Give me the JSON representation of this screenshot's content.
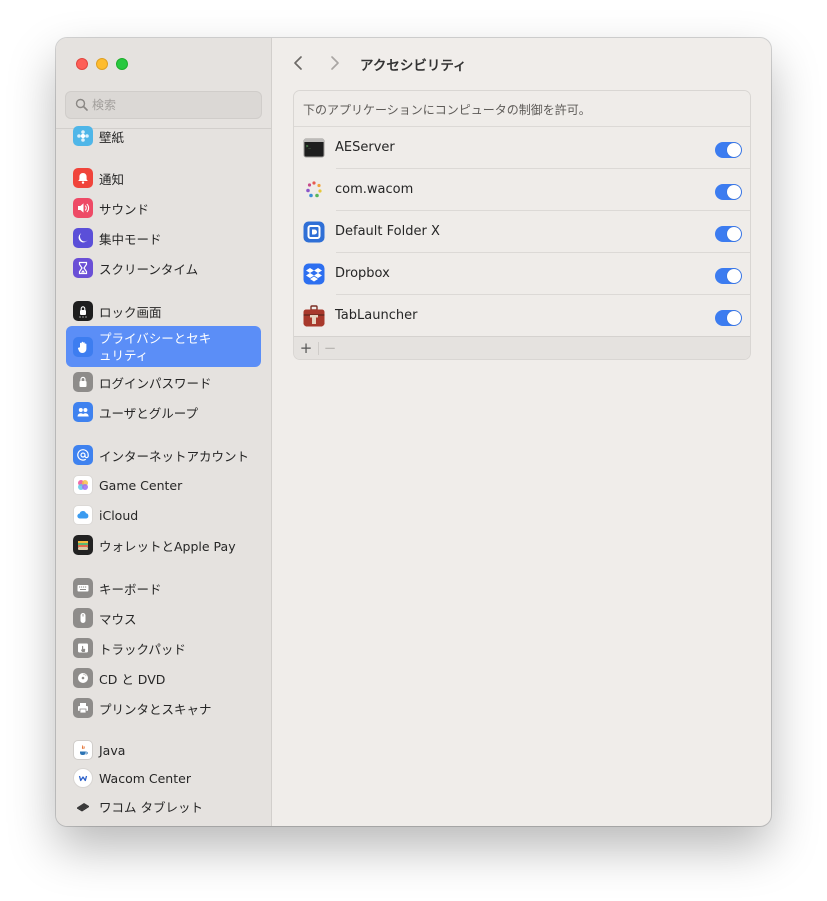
{
  "search": {
    "placeholder": "検索"
  },
  "sidebar": {
    "items": [
      {
        "label": "壁紙",
        "icon": "wallpaper-icon"
      },
      {
        "label": "通知",
        "icon": "bell-icon"
      },
      {
        "label": "サウンド",
        "icon": "speaker-icon"
      },
      {
        "label": "集中モード",
        "icon": "moon-icon"
      },
      {
        "label": "スクリーンタイム",
        "icon": "hourglass-icon"
      },
      {
        "label": "ロック画面",
        "icon": "lock-screen-icon"
      },
      {
        "label": "プライバシーとセキュリティ",
        "icon": "hand-icon",
        "selected": true
      },
      {
        "label": "ログインパスワード",
        "icon": "lock-icon"
      },
      {
        "label": "ユーザとグループ",
        "icon": "users-icon"
      },
      {
        "label": "インターネットアカウント",
        "icon": "at-icon"
      },
      {
        "label": "Game Center",
        "icon": "game-center-icon"
      },
      {
        "label": "iCloud",
        "icon": "cloud-icon"
      },
      {
        "label": "ウォレットとApple Pay",
        "icon": "wallet-icon"
      },
      {
        "label": "キーボード",
        "icon": "keyboard-icon"
      },
      {
        "label": "マウス",
        "icon": "mouse-icon"
      },
      {
        "label": "トラックパッド",
        "icon": "trackpad-icon"
      },
      {
        "label": "CD と DVD",
        "icon": "disc-icon"
      },
      {
        "label": "プリンタとスキャナ",
        "icon": "printer-icon"
      },
      {
        "label": "Java",
        "icon": "java-icon"
      },
      {
        "label": "Wacom Center",
        "icon": "wacom-icon"
      },
      {
        "label": "ワコム タブレット",
        "icon": "tablet-icon"
      }
    ]
  },
  "toolbar": {
    "title": "アクセシビリティ"
  },
  "panel": {
    "header": "下のアプリケーションにコンピュータの制御を許可。",
    "apps": [
      {
        "name": "AEServer",
        "enabled": true
      },
      {
        "name": "com.wacom",
        "enabled": true
      },
      {
        "name": "Default Folder X",
        "enabled": true
      },
      {
        "name": "Dropbox",
        "enabled": true
      },
      {
        "name": "TabLauncher",
        "enabled": true
      }
    ],
    "add_label": "+",
    "remove_label": "−"
  },
  "colors": {
    "accent": "#3c7cf0",
    "selection": "#5b8ef7"
  }
}
